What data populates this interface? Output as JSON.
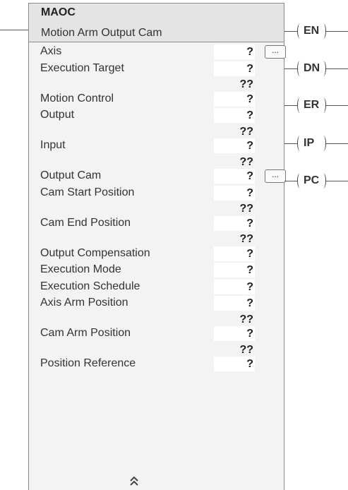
{
  "block": {
    "name": "MAOC",
    "description": "Motion Arm Output Cam",
    "browse_label": "...",
    "collapse_icon": "double-chevron-up-icon"
  },
  "rows": [
    {
      "label": "Axis",
      "value": "?",
      "sub": null,
      "browse": true
    },
    {
      "label": "Execution Target",
      "value": "?",
      "sub": "??",
      "browse": false
    },
    {
      "label": "Motion Control",
      "value": "?",
      "sub": null,
      "browse": false
    },
    {
      "label": "Output",
      "value": "?",
      "sub": "??",
      "browse": false
    },
    {
      "label": "Input",
      "value": "?",
      "sub": "??",
      "browse": false
    },
    {
      "label": "Output Cam",
      "value": "?",
      "sub": null,
      "browse": true
    },
    {
      "label": "Cam Start Position",
      "value": "?",
      "sub": "??",
      "browse": false
    },
    {
      "label": "Cam End Position",
      "value": "?",
      "sub": "??",
      "browse": false
    },
    {
      "label": "Output Compensation",
      "value": "?",
      "sub": null,
      "browse": false
    },
    {
      "label": "Execution Mode",
      "value": "?",
      "sub": null,
      "browse": false
    },
    {
      "label": "Execution Schedule",
      "value": "?",
      "sub": null,
      "browse": false
    },
    {
      "label": "Axis Arm Position",
      "value": "?",
      "sub": "??",
      "browse": false
    },
    {
      "label": "Cam Arm Position",
      "value": "?",
      "sub": "??",
      "browse": false
    },
    {
      "label": "Position Reference",
      "value": "?",
      "sub": null,
      "browse": false
    }
  ],
  "outputs": [
    "EN",
    "DN",
    "ER",
    "IP",
    "PC"
  ]
}
